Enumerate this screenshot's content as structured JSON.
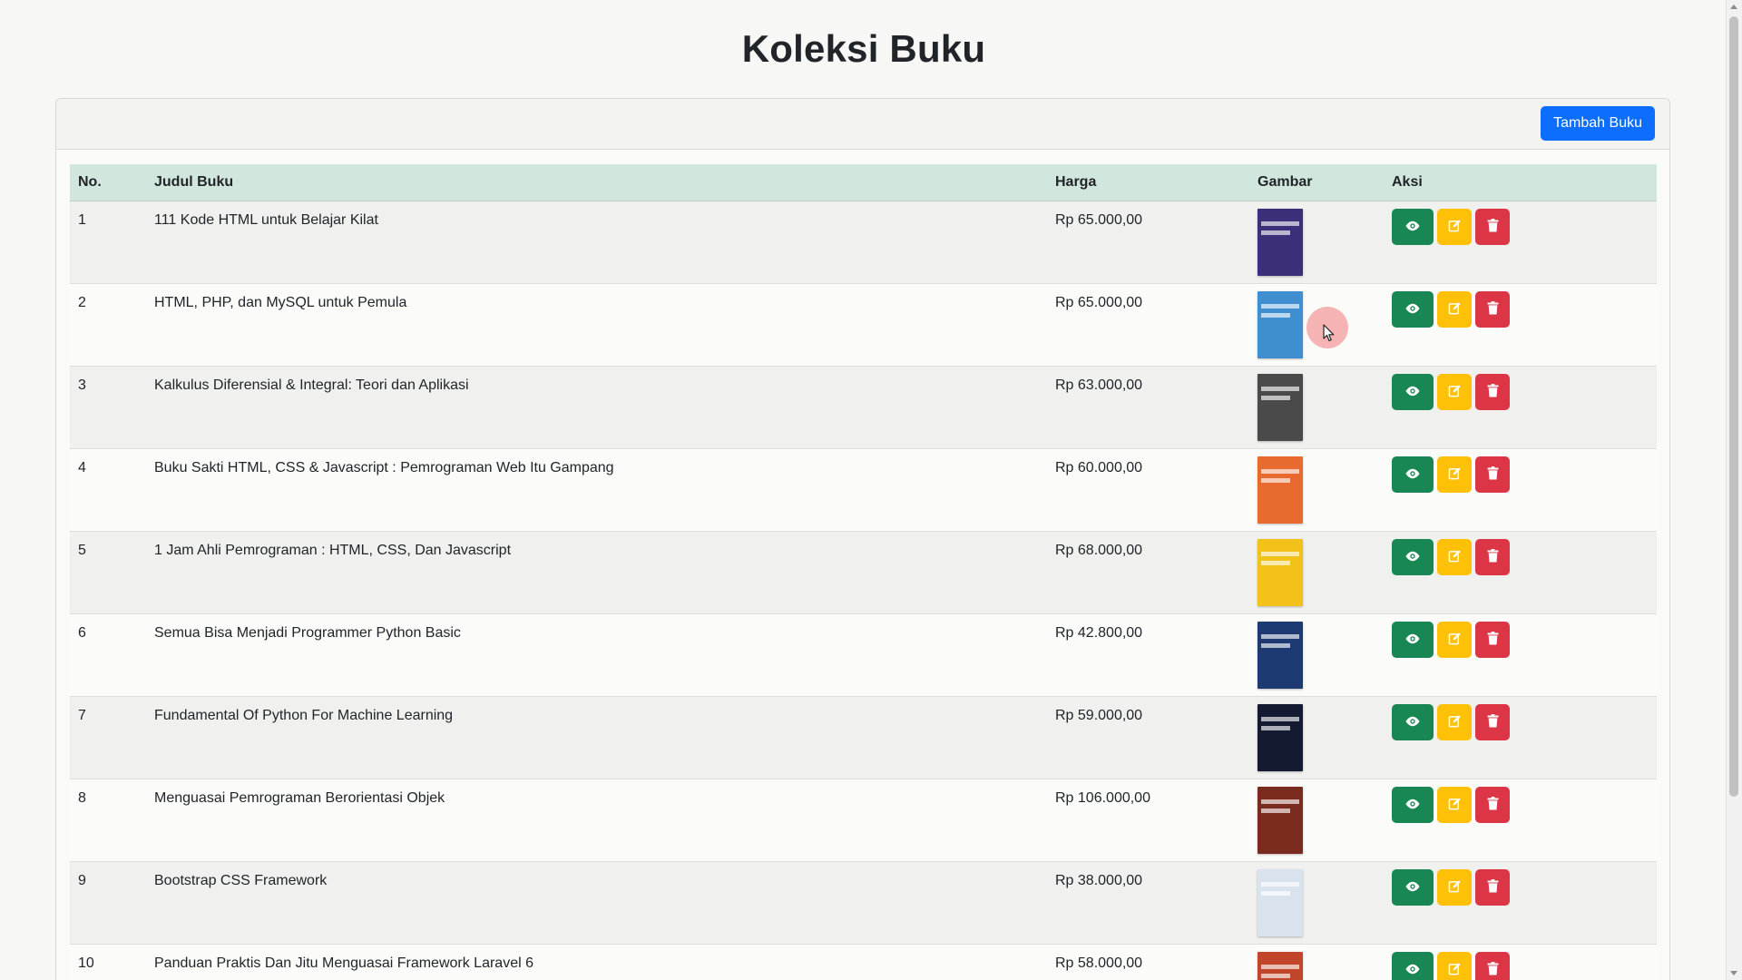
{
  "page": {
    "title": "Koleksi Buku"
  },
  "toolbar": {
    "add_label": "Tambah Buku"
  },
  "table": {
    "headers": {
      "no": "No.",
      "title": "Judul Buku",
      "price": "Harga",
      "image": "Gambar",
      "actions": "Aksi"
    },
    "rows": [
      {
        "no": "1",
        "title": "111 Kode HTML untuk Belajar Kilat",
        "price": "Rp 65.000,00",
        "cover_color": "#3b2f7a"
      },
      {
        "no": "2",
        "title": "HTML, PHP, dan MySQL untuk Pemula",
        "price": "Rp 65.000,00",
        "cover_color": "#3f8fd0"
      },
      {
        "no": "3",
        "title": "Kalkulus Diferensial & Integral: Teori dan Aplikasi",
        "price": "Rp 63.000,00",
        "cover_color": "#4a4a4a"
      },
      {
        "no": "4",
        "title": "Buku Sakti HTML, CSS & Javascript : Pemrograman Web Itu Gampang",
        "price": "Rp 60.000,00",
        "cover_color": "#e86a2e"
      },
      {
        "no": "5",
        "title": "1 Jam Ahli Pemrograman : HTML, CSS, Dan Javascript",
        "price": "Rp 68.000,00",
        "cover_color": "#f2c21a"
      },
      {
        "no": "6",
        "title": "Semua Bisa Menjadi Programmer Python Basic",
        "price": "Rp 42.800,00",
        "cover_color": "#1d3a73"
      },
      {
        "no": "7",
        "title": "Fundamental Of Python For Machine Learning",
        "price": "Rp 59.000,00",
        "cover_color": "#151a33"
      },
      {
        "no": "8",
        "title": "Menguasai Pemrograman Berorientasi Objek",
        "price": "Rp 106.000,00",
        "cover_color": "#7a2b1e"
      },
      {
        "no": "9",
        "title": "Bootstrap CSS Framework",
        "price": "Rp 38.000,00",
        "cover_color": "#d9e3ee"
      },
      {
        "no": "10",
        "title": "Panduan Praktis Dan Jitu Menguasai Framework Laravel 6",
        "price": "Rp 58.000,00",
        "cover_color": "#c0452a"
      }
    ]
  },
  "icons": {
    "view": "eye-icon",
    "edit": "edit-icon",
    "delete": "trash-icon"
  },
  "colors": {
    "primary": "#0d6efd",
    "success": "#198754",
    "warning": "#ffc107",
    "danger": "#dc3545",
    "table_head": "#d1e7dd"
  }
}
